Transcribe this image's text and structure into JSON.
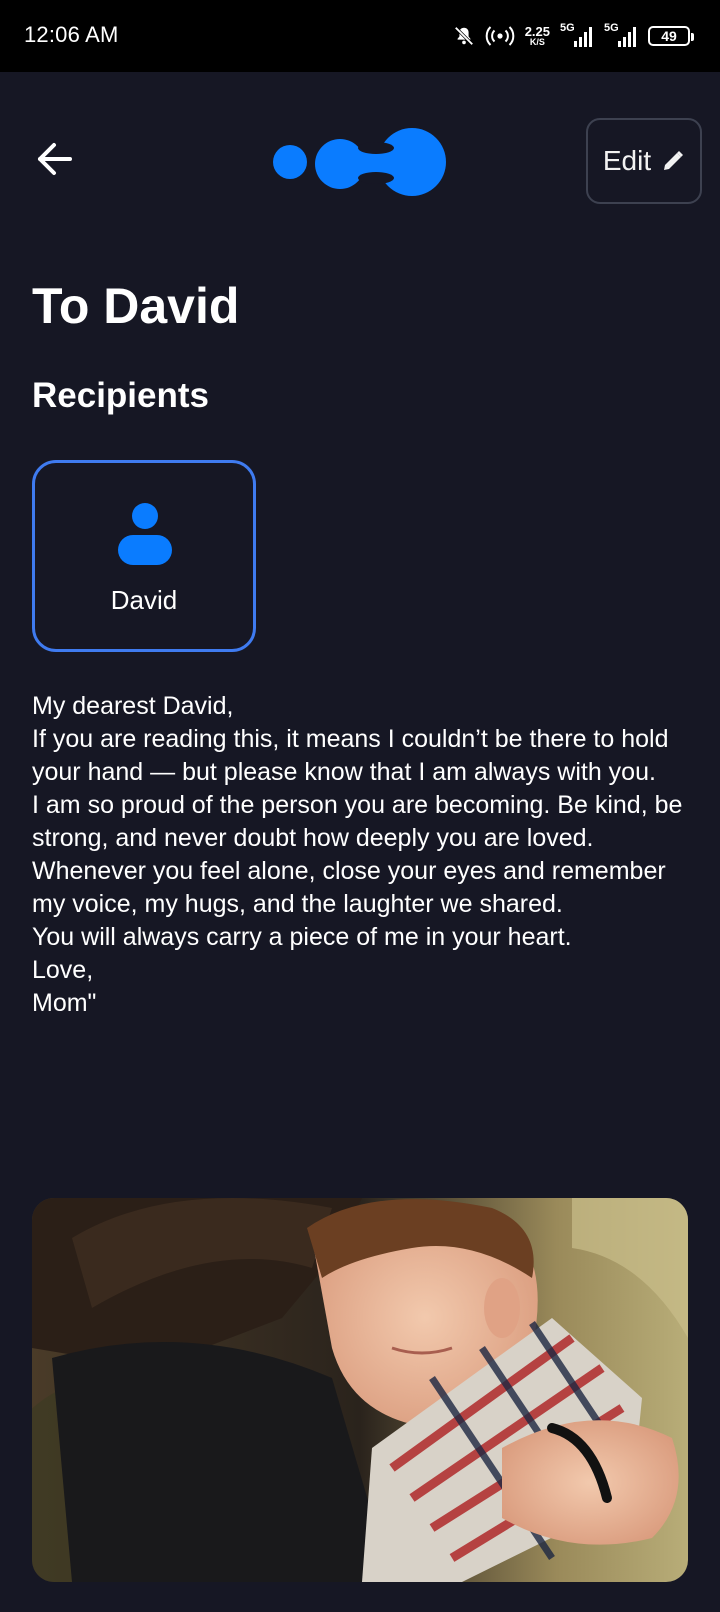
{
  "status_bar": {
    "time": "12:06 AM",
    "net_speed_value": "2.25",
    "net_speed_unit": "K/S",
    "signal_1_label": "5G",
    "signal_2_label": "5G",
    "battery_level": "49"
  },
  "header": {
    "back_icon": "arrow-left-icon",
    "logo_icon": "blob-logo-icon",
    "edit_label": "Edit",
    "edit_icon": "pencil-icon"
  },
  "page": {
    "title": "To David",
    "recipients_heading": "Recipients"
  },
  "recipients": [
    {
      "name": "David",
      "icon": "person-icon"
    }
  ],
  "letter_lines": [
    "My dearest David,",
    "If you are reading this, it means I couldn’t be there to hold your hand — but please know that I am always with you.",
    "I am so proud of the person you are becoming. Be kind, be strong, and never doubt how deeply you are loved.",
    "Whenever you feel alone, close your eyes and remember my voice, my hugs, and the laughter we shared.",
    "You will always carry a piece of me in your heart.",
    "Love,",
    "Mom\""
  ],
  "colors": {
    "background": "#161724",
    "accent_blue": "#0a7cff",
    "card_border": "#3f7bf0",
    "edit_border": "#3d4150"
  }
}
